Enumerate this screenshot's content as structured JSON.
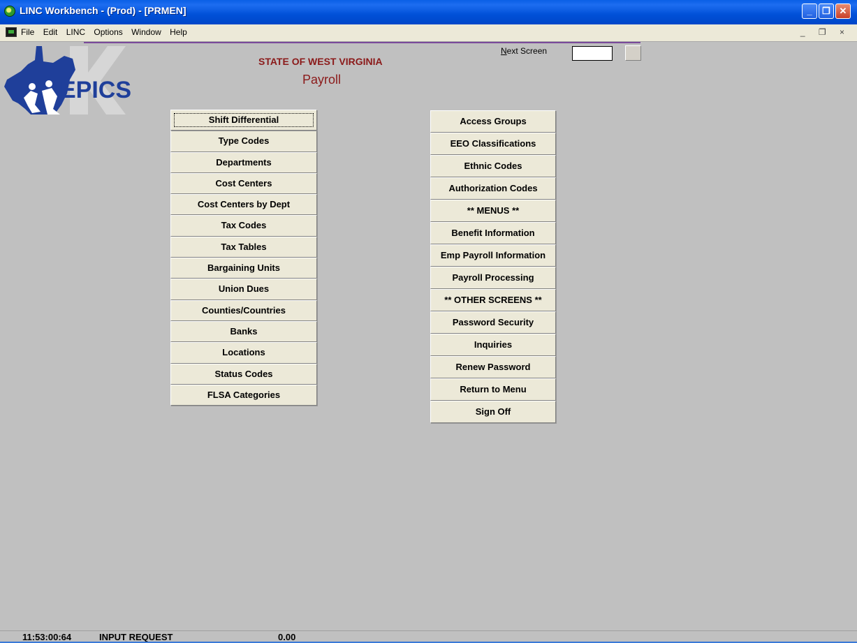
{
  "window": {
    "title": "LINC Workbench - (Prod) - [PRMEN]",
    "controls": {
      "minimize": "_",
      "maximize": "❐",
      "close": "✕"
    }
  },
  "menubar": {
    "items": [
      "File",
      "Edit",
      "LINC",
      "Options",
      "Window",
      "Help"
    ],
    "mdi_controls": {
      "minimize": "_",
      "restore": "❐",
      "close": "×"
    }
  },
  "logo": {
    "text": "EPICS"
  },
  "header": {
    "state": "STATE OF WEST VIRGINIA",
    "title": "Payroll"
  },
  "next_screen": {
    "label": "Next Screen",
    "value": ""
  },
  "left_buttons": [
    "Shift Differential",
    "Type Codes",
    "Departments",
    "Cost Centers",
    "Cost Centers by Dept",
    "Tax Codes",
    "Tax Tables",
    "Bargaining Units",
    "Union Dues",
    "Counties/Countries",
    "Banks",
    "Locations",
    "Status Codes",
    "FLSA Categories"
  ],
  "right_buttons": [
    "Access Groups",
    "EEO Classifications",
    "Ethnic Codes",
    "Authorization Codes",
    "** MENUS **",
    "Benefit Information",
    "Emp Payroll Information",
    "Payroll Processing",
    "** OTHER SCREENS **",
    "Password Security",
    "Inquiries",
    "Renew Password",
    "Return to Menu",
    "Sign Off"
  ],
  "status": {
    "time": "11:53:00:64",
    "state": "INPUT REQUEST",
    "value": "0.00"
  },
  "colors": {
    "title_bar": "#0050d8",
    "background": "#c0c0c0",
    "header_text": "#8b1a1a",
    "logo": "#1f3f9a"
  }
}
